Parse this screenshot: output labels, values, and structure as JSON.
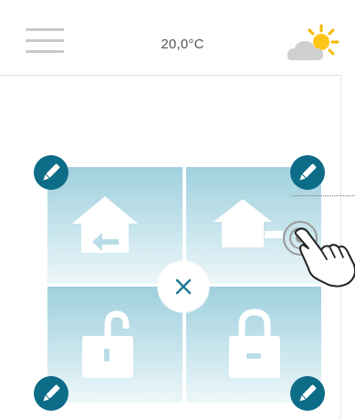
{
  "header": {
    "menu_icon": "hamburger-menu-icon",
    "temperature": "20,0°C",
    "weather_icon": "partly-cloudy-sun-icon"
  },
  "tiles": [
    {
      "icon": "house-arrow-in-icon",
      "position": "top-left"
    },
    {
      "icon": "house-arrow-out-icon",
      "position": "top-right"
    },
    {
      "icon": "padlock-unlocked-icon",
      "position": "bottom-left"
    },
    {
      "icon": "padlock-locked-icon",
      "position": "bottom-right"
    }
  ],
  "close_button": {
    "icon": "close-icon"
  },
  "edit_buttons": {
    "icon": "pencil-icon",
    "count": 4
  },
  "colors": {
    "accent": "#0d6c88",
    "tile_top": "#9fd0dd",
    "tile_bottom": "#eef7fa",
    "close_x": "#1f7a96",
    "header_text": "#555555"
  },
  "gesture": {
    "icon": "pointing-hand-icon",
    "target": "top-right-tile"
  }
}
